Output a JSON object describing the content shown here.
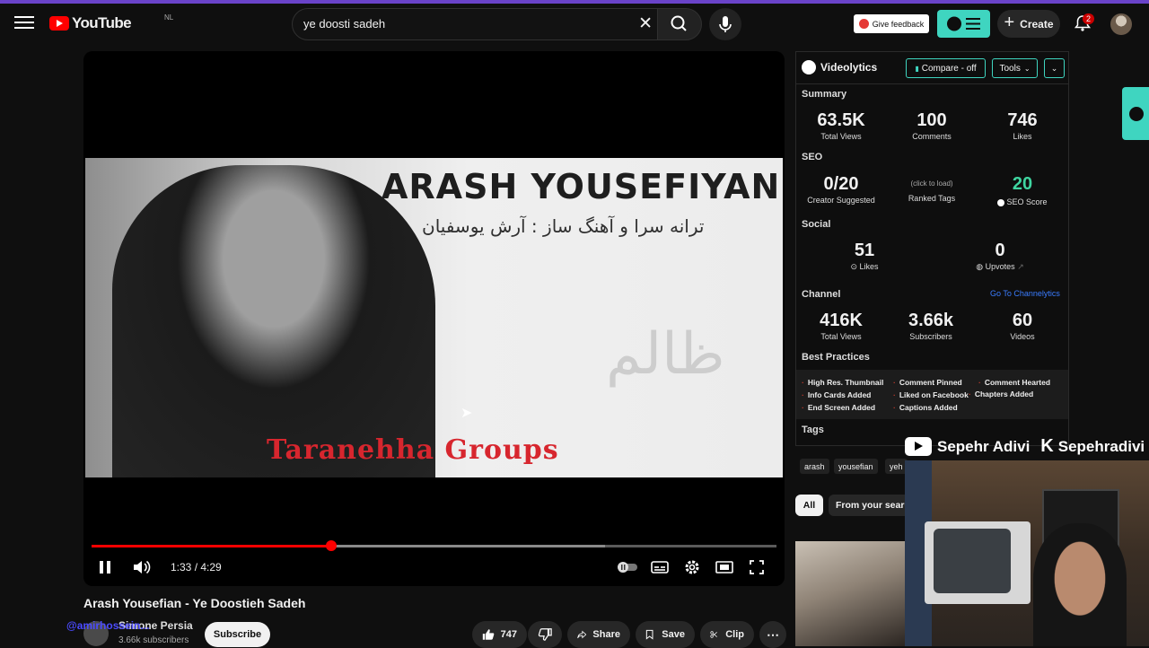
{
  "header": {
    "logo_text": "YouTube",
    "country_code": "NL",
    "search_value": "ye doosti sadeh",
    "feedback_label": "Give feedback",
    "create_label": "Create",
    "notifications_count": "2"
  },
  "player": {
    "frame_title": "ARASH YOUSEFIYAN",
    "frame_subtitle": "ترانه سرا و آهنگ ساز : آرش یوسفیان",
    "frame_watermark": "ظالم",
    "frame_group": "Taranehha Groups",
    "time": "1:33 / 4:29",
    "progress_played": 0.35,
    "progress_buffered": 0.75
  },
  "video": {
    "title": "Arash Yousefian - Ye Doostieh Sadeh",
    "channel_name": "Simone Persia",
    "overlay_handle": "@amirhossein...",
    "subscribers": "3.66k subscribers",
    "subscribe_label": "Subscribe",
    "likes": "747",
    "share_label": "Share",
    "save_label": "Save",
    "clip_label": "Clip"
  },
  "panel": {
    "name": "Videolytics",
    "compare_label": "Compare - off",
    "tools_label": "Tools",
    "summary_title": "Summary",
    "summary": [
      {
        "value": "63.5K",
        "label": "Total Views"
      },
      {
        "value": "100",
        "label": "Comments"
      },
      {
        "value": "746",
        "label": "Likes"
      }
    ],
    "seo_title": "SEO",
    "seo": [
      {
        "value": "0/20",
        "label": "Creator Suggested"
      },
      {
        "value": "(click to load)",
        "label": "Ranked Tags"
      },
      {
        "value": "20",
        "label": "SEO Score"
      }
    ],
    "social_title": "Social",
    "social": [
      {
        "value": "51",
        "label": "Likes"
      },
      {
        "value": "0",
        "label": "Upvotes"
      }
    ],
    "channel_title": "Channel",
    "channel_link": "Go To Channelytics",
    "channel": [
      {
        "value": "416K",
        "label": "Total Views"
      },
      {
        "value": "3.66k",
        "label": "Subscribers"
      },
      {
        "value": "60",
        "label": "Videos"
      }
    ],
    "best_practices_title": "Best Practices",
    "best_practices": [
      "High Res. Thumbnail",
      "Comment Pinned",
      "Comment Hearted",
      "Info Cards Added",
      "Liked on Facebook",
      "Chapters Added",
      "End Screen Added",
      "Captions Added"
    ],
    "tags_title": "Tags",
    "tags": [
      "arash",
      "yousefian",
      "yeh"
    ]
  },
  "sidebar": {
    "chip_all": "All",
    "chip_from": "From your search"
  },
  "overlay": {
    "youtube_name": "Sepehr Adivi",
    "kick_name": "Sepehradivi"
  },
  "colors": {
    "accent": "#3fd5c0",
    "progress": "#ff0000",
    "link": "#3a7cff"
  }
}
